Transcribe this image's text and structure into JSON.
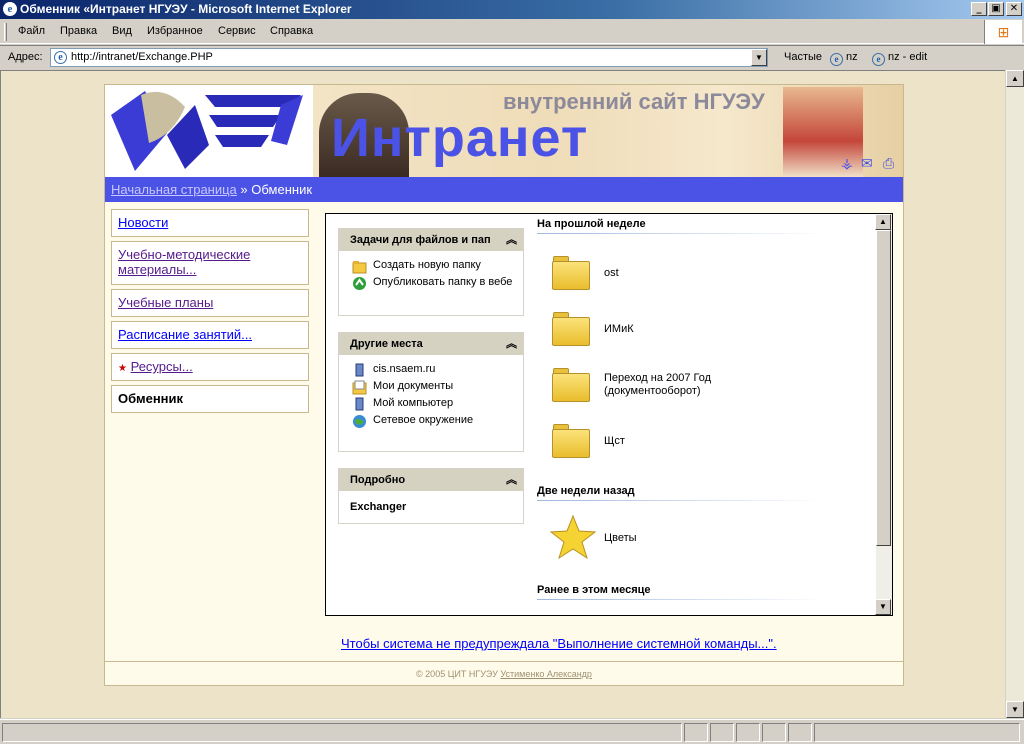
{
  "window": {
    "title": "Обменник «Интранет НГУЭУ - Microsoft Internet Explorer",
    "minimize": "_",
    "maximize": "▣",
    "close": "✕"
  },
  "menu": {
    "items": [
      "Файл",
      "Правка",
      "Вид",
      "Избранное",
      "Сервис",
      "Справка"
    ]
  },
  "address": {
    "label": "Адрес:",
    "url": "http://intranet/Exchange.PHP",
    "links": [
      {
        "label": "Частые"
      },
      {
        "label": "nz"
      },
      {
        "label": "nz - edit"
      }
    ]
  },
  "banner": {
    "subtitle": "внутренний сайт НГУЭУ",
    "title": "Интранет"
  },
  "breadcrumb": {
    "home": "Начальная страница",
    "separator": "»",
    "current": "Обменник"
  },
  "nav": {
    "items": [
      {
        "label": "Новости"
      },
      {
        "label": "Учебно-методические материалы..."
      },
      {
        "label": "Учебные планы"
      },
      {
        "label": "Расписание занятий..."
      },
      {
        "label": "Ресурсы..."
      },
      {
        "label": "Обменник"
      }
    ]
  },
  "tasks": {
    "file_tasks": {
      "title": "Задачи для файлов и пап",
      "items": [
        "Создать новую папку",
        "Опубликовать папку в вебе"
      ]
    },
    "other_places": {
      "title": "Другие места",
      "items": [
        "cis.nsaem.ru",
        "Мои документы",
        "Мой компьютер",
        "Сетевое окружение"
      ]
    },
    "details": {
      "title": "Подробно",
      "name": "Exchanger"
    }
  },
  "groups": {
    "last_week": "На прошлой неделе",
    "two_weeks": "Две недели назад",
    "this_month": "Ранее в этом месяце"
  },
  "files": [
    "ost",
    "ИМиК",
    "Переход на 2007 Год (документооборот)",
    "Щст",
    "Цветы"
  ],
  "warning_link": "Чтобы система не предупреждала \"Выполнение системной команды...\".",
  "footer": {
    "text": "© 2005 ЦИТ НГУЭУ",
    "author": "Устименко Александр"
  }
}
